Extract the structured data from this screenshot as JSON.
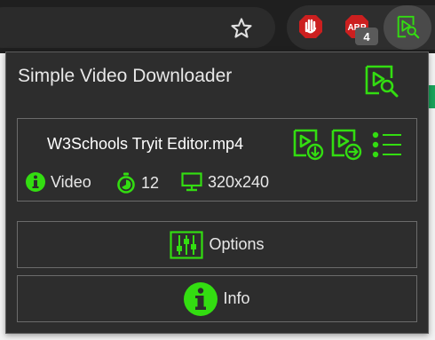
{
  "browser": {
    "ad_block_badge_count": "4",
    "ad_block_icon_text": "ABP"
  },
  "popup": {
    "title": "Simple Video Downloader",
    "video": {
      "filename": "W3Schools Tryit Editor.mp4",
      "type": "Video",
      "duration": "12",
      "resolution": "320x240"
    },
    "options_label": "Options",
    "info_label": "Info"
  },
  "colors": {
    "accent": "#33dd11",
    "popup_bg": "#2d2d2d",
    "toolbar_bg": "#1f1f1f",
    "stop_red": "#cc1f1f",
    "page_green": "#19a35a"
  },
  "icons": [
    "star-icon",
    "stop-hand-icon",
    "adblock-icon",
    "video-search-icon",
    "download-video-icon",
    "open-video-icon",
    "list-icon",
    "info-icon",
    "timer-icon",
    "monitor-icon",
    "sliders-icon"
  ]
}
